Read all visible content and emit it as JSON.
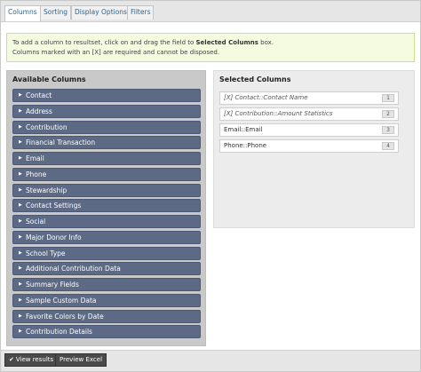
{
  "tabs": [
    {
      "label": "Columns"
    },
    {
      "label": "Sorting"
    },
    {
      "label": "Display Options"
    },
    {
      "label": "Filters"
    }
  ],
  "info": {
    "line1_pre": "To add a column to resultset, click on and drag the field to ",
    "line1_bold": "Selected Columns",
    "line1_post": " box.",
    "line2": "Columns marked with an [X] are required and cannot be disposed."
  },
  "available": {
    "title": "Available Columns",
    "items": [
      {
        "label": "Contact"
      },
      {
        "label": "Address"
      },
      {
        "label": "Contribution"
      },
      {
        "label": "Financial Transaction"
      },
      {
        "label": "Email"
      },
      {
        "label": "Phone"
      },
      {
        "label": "Stewardship"
      },
      {
        "label": "Contact Settings"
      },
      {
        "label": "Social"
      },
      {
        "label": "Major Donor Info"
      },
      {
        "label": "School Type"
      },
      {
        "label": "Additional Contribution Data"
      },
      {
        "label": "Summary Fields"
      },
      {
        "label": "Sample Custom Data"
      },
      {
        "label": "Favorite Colors by Date"
      },
      {
        "label": "Contribution Details"
      }
    ]
  },
  "selected": {
    "title": "Selected Columns",
    "items": [
      {
        "label": "[X] Contact::Contact Name",
        "num": "1"
      },
      {
        "label": "[X] Contribution::Amount Statistics",
        "num": "2"
      },
      {
        "label": "Email::Email",
        "num": "3"
      },
      {
        "label": "Phone::Phone",
        "num": "4"
      }
    ]
  },
  "footer": {
    "view_results": "View results",
    "preview_excel": "Preview Excel"
  },
  "icons": {
    "collapsed": "triangle-right-icon",
    "check": "check-icon"
  }
}
